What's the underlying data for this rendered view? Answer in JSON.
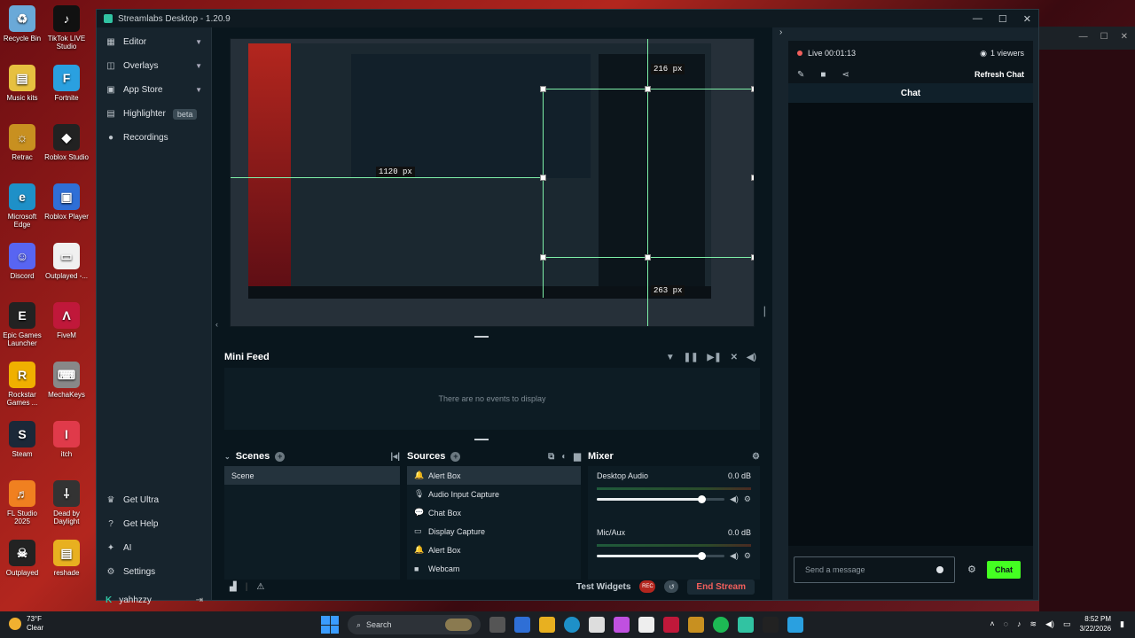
{
  "desktop": {
    "icons": [
      "Recycle Bin",
      "TikTok LIVE Studio",
      "Music kits",
      "Fortnite",
      "Retrac",
      "Roblox Studio",
      "Microsoft Edge",
      "Roblox Player",
      "Discord",
      "Outplayed -...",
      "Epic Games Launcher",
      "FiveM",
      "Rockstar Games ...",
      "MechaKeys",
      "Steam",
      "itch",
      "FL Studio 2025",
      "Dead by Daylight",
      "Outplayed",
      "reshade"
    ]
  },
  "app": {
    "title": "Streamlabs Desktop - 1.20.9",
    "nav": [
      {
        "label": "Editor",
        "icon": "editor-icon"
      },
      {
        "label": "Overlays",
        "icon": "overlays-icon"
      },
      {
        "label": "App Store",
        "icon": "app-store-icon"
      },
      {
        "label": "Highlighter",
        "icon": "highlighter-icon",
        "badge": "beta"
      },
      {
        "label": "Recordings",
        "icon": "recordings-icon"
      }
    ],
    "bottom_nav": [
      {
        "label": "Get Ultra"
      },
      {
        "label": "Get Help"
      },
      {
        "label": "AI"
      },
      {
        "label": "Settings"
      }
    ],
    "user": "yahhzzy"
  },
  "preview": {
    "measure_top": "216 px",
    "measure_left": "1120 px",
    "measure_bottom": "263 px"
  },
  "minifeed": {
    "title": "Mini Feed",
    "empty": "There are no events to display"
  },
  "scenes": {
    "title": "Scenes",
    "items": [
      "Scene"
    ]
  },
  "sources": {
    "title": "Sources",
    "items": [
      "Alert Box",
      "Audio Input Capture",
      "Chat Box",
      "Display Capture",
      "Alert Box",
      "Webcam"
    ]
  },
  "mixer": {
    "title": "Mixer",
    "channels": [
      {
        "name": "Desktop Audio",
        "level": "0.0 dB",
        "volume": 0.95
      },
      {
        "name": "Mic/Aux",
        "level": "0.0 dB",
        "volume": 0.95
      }
    ]
  },
  "footer": {
    "test_widgets": "Test Widgets",
    "end_stream": "End Stream"
  },
  "chat": {
    "live": "Live 00:01:13",
    "viewers": "1 viewers",
    "refresh": "Refresh Chat",
    "header": "Chat",
    "placeholder": "Send a message",
    "send": "Chat"
  },
  "taskbar": {
    "temp": "73°F",
    "condition": "Clear",
    "search": "Search",
    "time": "8:52 PM",
    "date": "3/22/2026"
  },
  "colors": {
    "accent": "#31c3a2",
    "chat_button": "#44ff22",
    "end_stream": "#f25f5c"
  }
}
